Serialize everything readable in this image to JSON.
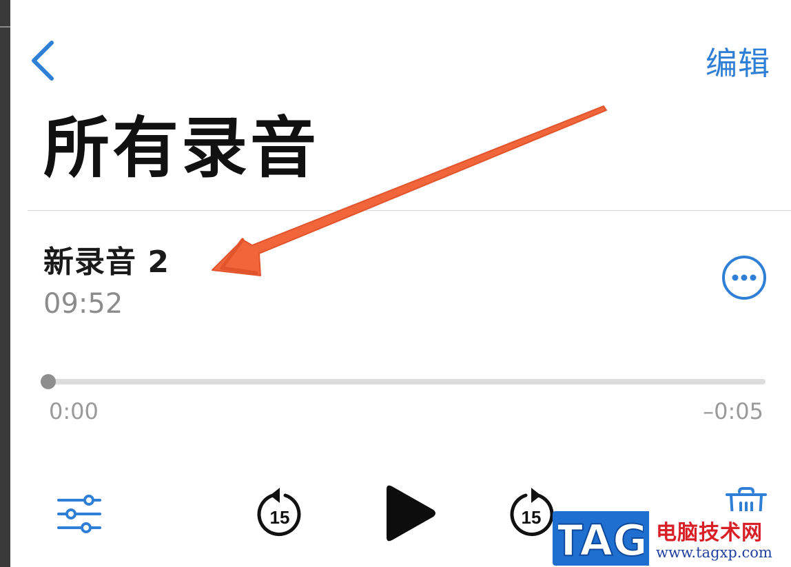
{
  "nav": {
    "edit_label": "编辑"
  },
  "page": {
    "title": "所有录音"
  },
  "recording": {
    "name": "新录音 2",
    "duration": "09:52"
  },
  "playback": {
    "progress_fraction": 0.0,
    "elapsed": "0:00",
    "remaining": "–0:05",
    "skip_seconds": "15"
  },
  "icons": {
    "back": "chevron-left-icon",
    "more": "ellipsis-circle-icon",
    "settings": "sliders-icon",
    "skip_back": "rewind-15-icon",
    "play": "play-icon",
    "skip_forward": "forward-15-icon",
    "delete": "trash-icon"
  },
  "colors": {
    "accent": "#2f7fd6",
    "title_text": "#111111",
    "secondary_text": "#8c8c8c",
    "annotation_arrow": "#f0653a",
    "watermark_blue": "#1f6fd1",
    "watermark_red": "#d81f26"
  },
  "watermark": {
    "logo_text": "TAG",
    "site_name": "电脑技术网",
    "site_url": "www.tagxp.com"
  }
}
